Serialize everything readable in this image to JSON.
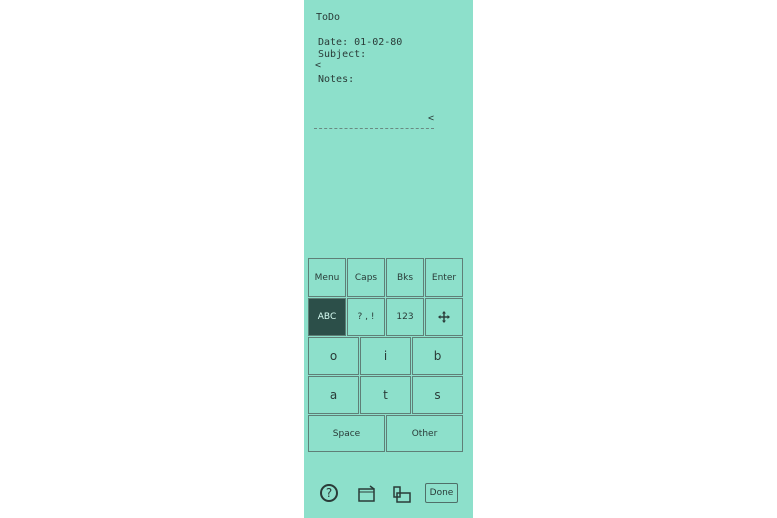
{
  "app": {
    "title": "ToDo"
  },
  "form": {
    "date_label": "Date:",
    "date_value": "01-02-80",
    "subject_label": "Subject:",
    "notes_label": "Notes:",
    "caret": "<"
  },
  "keyboard": {
    "row1": [
      "Menu",
      "Caps",
      "Bks",
      "Enter"
    ],
    "row2": [
      "ABC",
      "? , !",
      "123"
    ],
    "row3": [
      "o",
      "i",
      "b"
    ],
    "row4": [
      "a",
      "t",
      "s"
    ],
    "row5": [
      "Space",
      "Other"
    ]
  },
  "bottombar": {
    "help": "?",
    "done": "Done"
  },
  "colors": {
    "screen_bg": "#8de0cb",
    "text": "#2a3b38",
    "active_key": "#2c4f49"
  }
}
